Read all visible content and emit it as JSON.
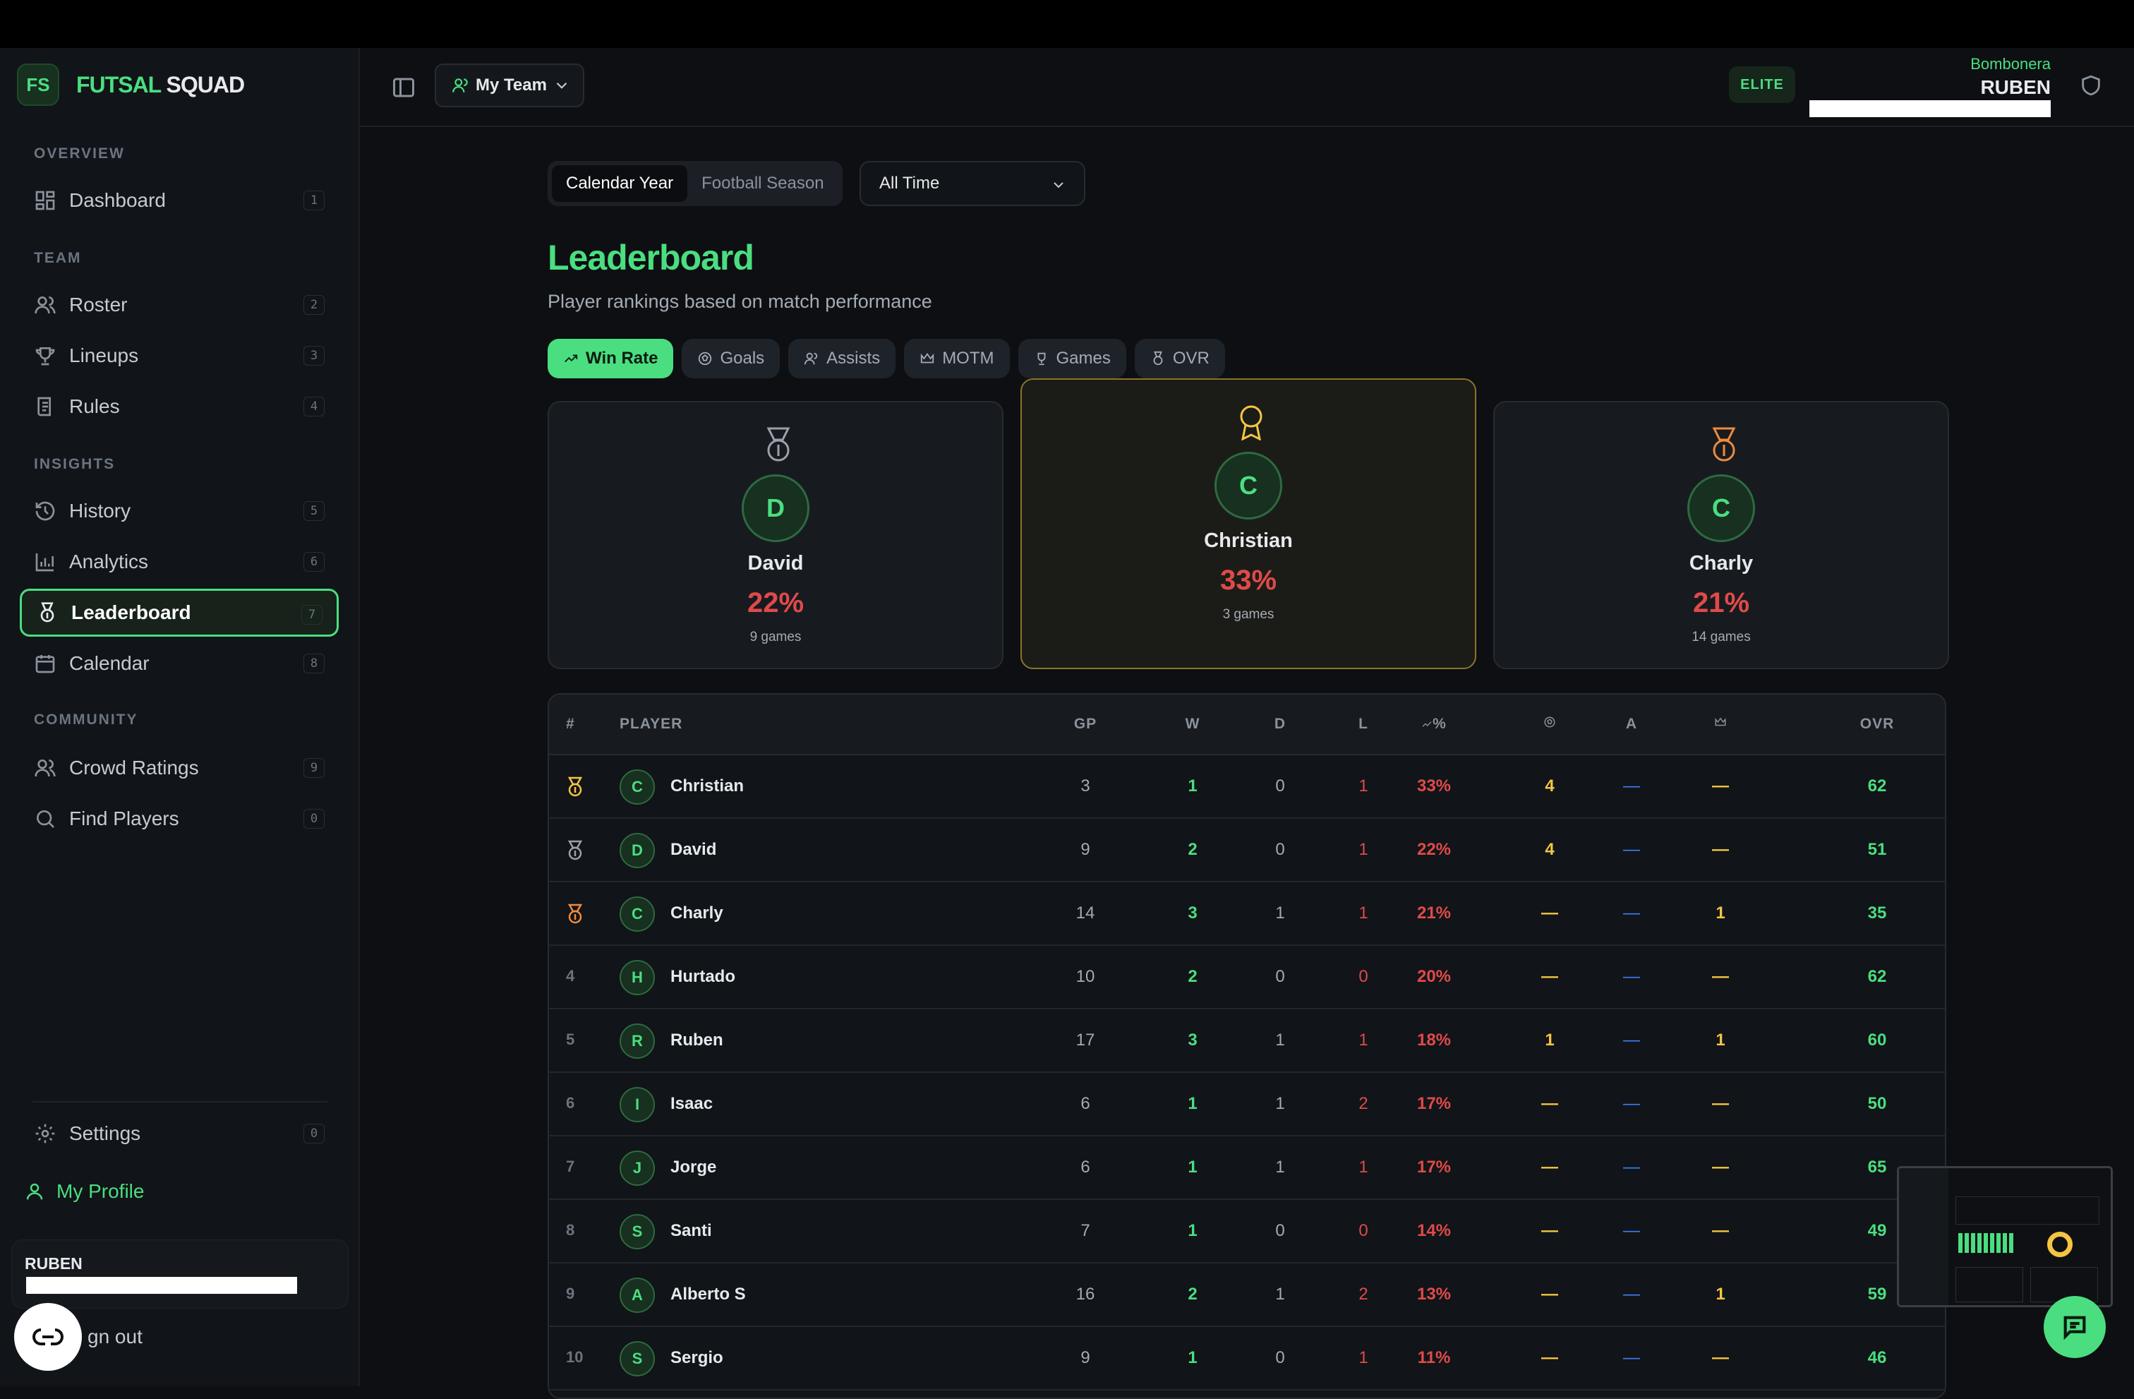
{
  "brand": {
    "badge": "FS",
    "name_a": "FUTSAL",
    "name_b": "SQUAD"
  },
  "sidebar": {
    "sections": [
      "OVERVIEW",
      "TEAM",
      "INSIGHTS",
      "COMMUNITY"
    ],
    "items": [
      {
        "label": "Dashboard",
        "key": "1",
        "icon": "dashboard-icon"
      },
      {
        "label": "Roster",
        "key": "2",
        "icon": "users-icon"
      },
      {
        "label": "Lineups",
        "key": "3",
        "icon": "trophy-icon"
      },
      {
        "label": "Rules",
        "key": "4",
        "icon": "rules-icon"
      },
      {
        "label": "History",
        "key": "5",
        "icon": "history-icon"
      },
      {
        "label": "Analytics",
        "key": "6",
        "icon": "bar-chart-icon"
      },
      {
        "label": "Leaderboard",
        "key": "7",
        "icon": "medal-icon"
      },
      {
        "label": "Calendar",
        "key": "8",
        "icon": "calendar-icon"
      },
      {
        "label": "Crowd Ratings",
        "key": "9",
        "icon": "users-icon"
      },
      {
        "label": "Find Players",
        "key": "0",
        "icon": "search-icon"
      }
    ],
    "settings": {
      "label": "Settings",
      "key": "0"
    },
    "my_profile": "My Profile",
    "user_name": "RUBEN",
    "sign_out": "gn out"
  },
  "header": {
    "team_button": "My Team",
    "tier_badge": "ELITE",
    "club": "Bombonera",
    "user": "RUBEN"
  },
  "filters": {
    "segments": [
      "Calendar Year",
      "Football Season"
    ],
    "selected_segment": "Calendar Year",
    "period": "All Time"
  },
  "page": {
    "title": "Leaderboard",
    "subtitle": "Player rankings based on match performance"
  },
  "metric_tabs": [
    "Win Rate",
    "Goals",
    "Assists",
    "MOTM",
    "Games",
    "OVR"
  ],
  "selected_metric": "Win Rate",
  "podium": [
    {
      "place": 2,
      "initial": "D",
      "name": "David",
      "value": "22%",
      "games": "9 games",
      "medal_color": "#9aa1aa"
    },
    {
      "place": 1,
      "initial": "C",
      "name": "Christian",
      "value": "33%",
      "games": "3 games",
      "medal_color": "#f5c542"
    },
    {
      "place": 3,
      "initial": "C",
      "name": "Charly",
      "value": "21%",
      "games": "14 games",
      "medal_color": "#f08a3c"
    }
  ],
  "table": {
    "headers": {
      "rank": "#",
      "player": "PLAYER",
      "gp": "GP",
      "w": "W",
      "d": "D",
      "l": "L",
      "winpct": "%",
      "a": "A",
      "ovr": "OVR"
    },
    "rows": [
      {
        "rank": "",
        "initial": "C",
        "name": "Christian",
        "gp": "3",
        "w": "1",
        "d": "0",
        "l": "1",
        "pct": "33%",
        "goals": "4",
        "assists": "—",
        "motm": "—",
        "ovr": "62"
      },
      {
        "rank": "",
        "initial": "D",
        "name": "David",
        "gp": "9",
        "w": "2",
        "d": "0",
        "l": "1",
        "pct": "22%",
        "goals": "4",
        "assists": "—",
        "motm": "—",
        "ovr": "51"
      },
      {
        "rank": "",
        "initial": "C",
        "name": "Charly",
        "gp": "14",
        "w": "3",
        "d": "1",
        "l": "1",
        "pct": "21%",
        "goals": "—",
        "assists": "—",
        "motm": "1",
        "ovr": "35"
      },
      {
        "rank": "4",
        "initial": "H",
        "name": "Hurtado",
        "gp": "10",
        "w": "2",
        "d": "0",
        "l": "0",
        "pct": "20%",
        "goals": "—",
        "assists": "—",
        "motm": "—",
        "ovr": "62"
      },
      {
        "rank": "5",
        "initial": "R",
        "name": "Ruben",
        "gp": "17",
        "w": "3",
        "d": "1",
        "l": "1",
        "pct": "18%",
        "goals": "1",
        "assists": "—",
        "motm": "1",
        "ovr": "60"
      },
      {
        "rank": "6",
        "initial": "I",
        "name": "Isaac",
        "gp": "6",
        "w": "1",
        "d": "1",
        "l": "2",
        "pct": "17%",
        "goals": "—",
        "assists": "—",
        "motm": "—",
        "ovr": "50"
      },
      {
        "rank": "7",
        "initial": "J",
        "name": "Jorge",
        "gp": "6",
        "w": "1",
        "d": "1",
        "l": "1",
        "pct": "17%",
        "goals": "—",
        "assists": "—",
        "motm": "—",
        "ovr": "65"
      },
      {
        "rank": "8",
        "initial": "S",
        "name": "Santi",
        "gp": "7",
        "w": "1",
        "d": "0",
        "l": "0",
        "pct": "14%",
        "goals": "—",
        "assists": "—",
        "motm": "—",
        "ovr": "49"
      },
      {
        "rank": "9",
        "initial": "A",
        "name": "Alberto S",
        "gp": "16",
        "w": "2",
        "d": "1",
        "l": "2",
        "pct": "13%",
        "goals": "—",
        "assists": "—",
        "motm": "1",
        "ovr": "59"
      },
      {
        "rank": "10",
        "initial": "S",
        "name": "Sergio",
        "gp": "9",
        "w": "1",
        "d": "0",
        "l": "1",
        "pct": "11%",
        "goals": "—",
        "assists": "—",
        "motm": "—",
        "ovr": "46"
      }
    ]
  },
  "colors": {
    "accent": "#4ade80",
    "gold": "#f5c542",
    "silver": "#9aa1aa",
    "bronze": "#f08a3c",
    "loss": "#e04a4a",
    "assist": "#3b82f6"
  }
}
